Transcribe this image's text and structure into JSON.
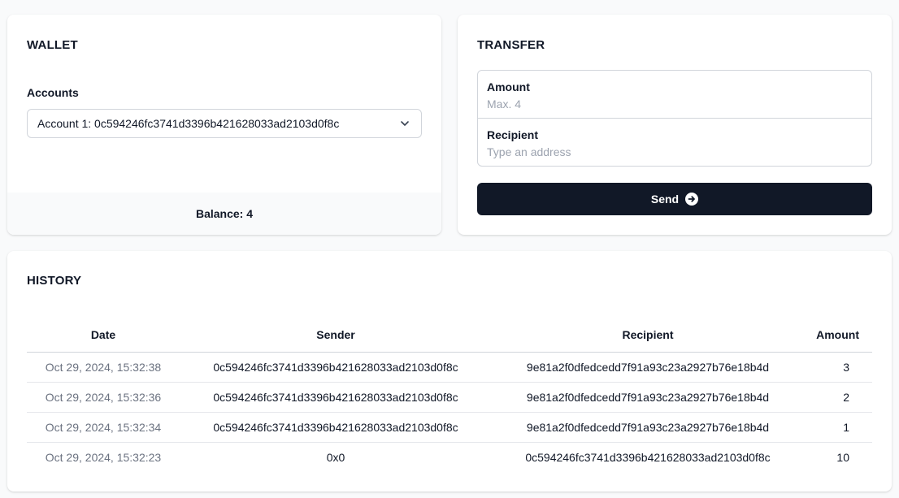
{
  "wallet": {
    "title": "WALLET",
    "accounts_label": "Accounts",
    "selected_account": "Account 1: 0c594246fc3741d3396b421628033ad2103d0f8c",
    "balance_text": "Balance: 4"
  },
  "transfer": {
    "title": "TRANSFER",
    "amount_label": "Amount",
    "amount_placeholder": "Max. 4",
    "amount_value": "",
    "recipient_label": "Recipient",
    "recipient_placeholder": "Type an address",
    "recipient_value": "",
    "send_label": "Send"
  },
  "history": {
    "title": "HISTORY",
    "columns": [
      "Date",
      "Sender",
      "Recipient",
      "Amount"
    ],
    "rows": [
      {
        "date": "Oct 29, 2024, 15:32:38",
        "sender": "0c594246fc3741d3396b421628033ad2103d0f8c",
        "recipient": "9e81a2f0dfedcedd7f91a93c23a2927b76e18b4d",
        "amount": "3"
      },
      {
        "date": "Oct 29, 2024, 15:32:36",
        "sender": "0c594246fc3741d3396b421628033ad2103d0f8c",
        "recipient": "9e81a2f0dfedcedd7f91a93c23a2927b76e18b4d",
        "amount": "2"
      },
      {
        "date": "Oct 29, 2024, 15:32:34",
        "sender": "0c594246fc3741d3396b421628033ad2103d0f8c",
        "recipient": "9e81a2f0dfedcedd7f91a93c23a2927b76e18b4d",
        "amount": "1"
      },
      {
        "date": "Oct 29, 2024, 15:32:23",
        "sender": "0x0",
        "recipient": "0c594246fc3741d3396b421628033ad2103d0f8c",
        "amount": "10"
      }
    ]
  },
  "colors": {
    "primary_button": "#111827",
    "page_background": "#f9fafb",
    "muted_text": "#6b7280",
    "border": "#d1d5db"
  },
  "icons": {
    "account_select": "chevron-down-icon",
    "send_button": "arrow-right-circle-icon"
  }
}
